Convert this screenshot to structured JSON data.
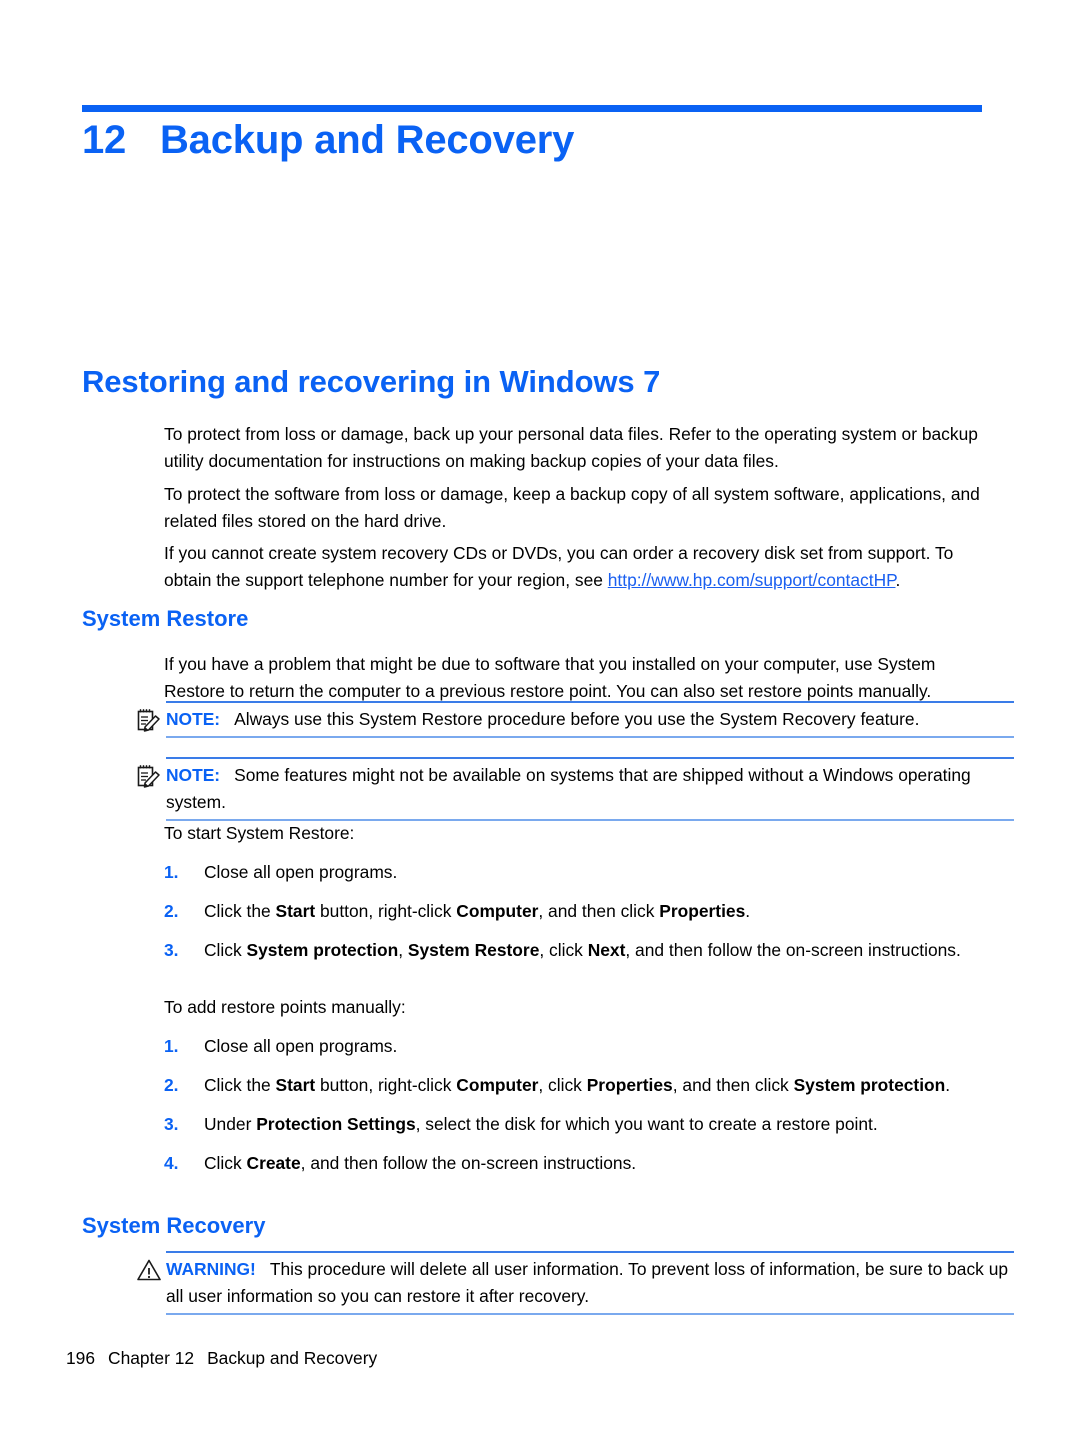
{
  "chapter": {
    "number": "12",
    "title": "Backup and Recovery"
  },
  "headings": {
    "h1": "Restoring and recovering in Windows 7",
    "system_restore": "System Restore",
    "system_recovery": "System Recovery"
  },
  "paragraphs": {
    "p1": "To protect from loss or damage, back up your personal data files. Refer to the operating system or backup utility documentation for instructions on making backup copies of your data files.",
    "p2": "To protect the software from loss or damage, keep a backup copy of all system software, applications, and related files stored on the hard drive.",
    "p3_before_link": "If you cannot create system recovery CDs or DVDs, you can order a recovery disk set from support. To obtain the support telephone number for your region, see ",
    "p3_link": "http://www.hp.com/support/contactHP",
    "p3_after_link": ".",
    "p4": "If you have a problem that might be due to software that you installed on your computer, use System Restore to return the computer to a previous restore point. You can also set restore points manually.",
    "start_system_restore": "To start System Restore:",
    "add_restore_points": "To add restore points manually:"
  },
  "notes": [
    {
      "icon": "note-icon",
      "label": "NOTE:",
      "text": "Always use this System Restore procedure before you use the System Recovery feature."
    },
    {
      "icon": "note-icon",
      "label": "NOTE:",
      "text": "Some features might not be available on systems that are shipped without a Windows operating system."
    }
  ],
  "warning": {
    "icon": "warning-triangle-icon",
    "label": "WARNING!",
    "text": "This procedure will delete all user information. To prevent loss of information, be sure to back up all user information so you can restore it after recovery."
  },
  "list_start_system_restore": [
    {
      "num": "1.",
      "text": "Close all open programs."
    },
    {
      "num": "2.",
      "text": "Click the Start button, right-click Computer, and then click Properties."
    },
    {
      "num": "3.",
      "text": "Click System protection, System Restore, click Next, and then follow the on-screen instructions."
    }
  ],
  "list_add_restore_points": [
    {
      "num": "1.",
      "text": "Close all open programs."
    },
    {
      "num": "2.",
      "text": "Click the Start button, right-click Computer, click Properties, and then click System protection."
    },
    {
      "num": "3.",
      "text": "Under Protection Settings, select the disk for which you want to create a restore point."
    },
    {
      "num": "4.",
      "text": "Click Create, and then follow the on-screen instructions."
    }
  ],
  "footer": {
    "page_number": "196",
    "chapter_label": "Chapter 12",
    "chapter_title": "Backup and Recovery"
  },
  "colors": {
    "accent_blue": "#0a62f4",
    "link_blue": "#1a5ff0",
    "rule_blue_top": "#3a7ce8",
    "rule_blue_bottom": "#7aa9ee",
    "text_black": "#000000"
  }
}
